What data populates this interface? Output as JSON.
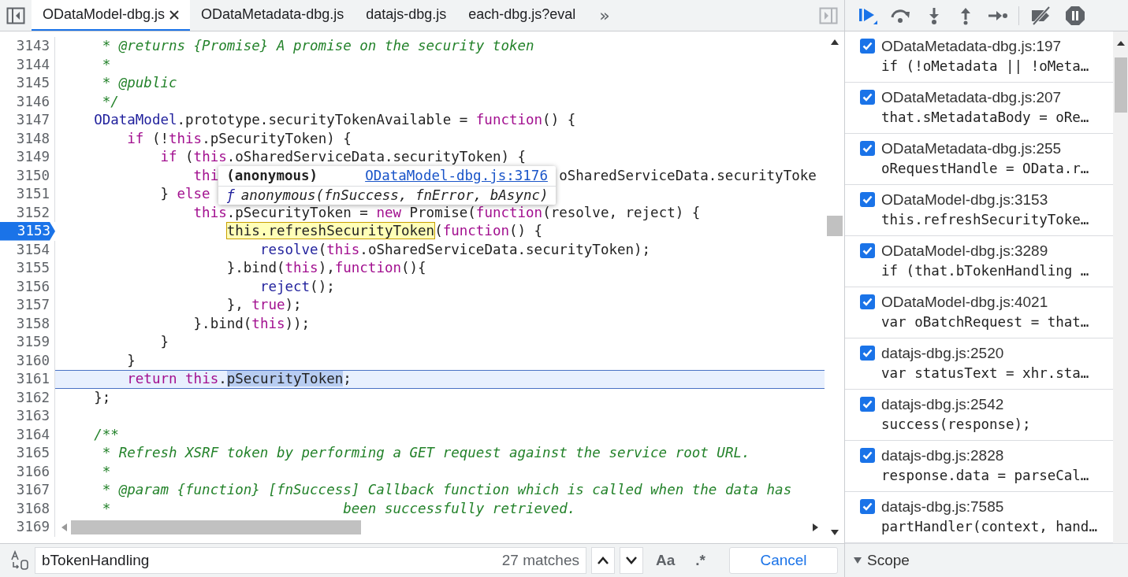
{
  "tabs": [
    {
      "label": "ODataModel-dbg.js",
      "selected": true
    },
    {
      "label": "ODataMetadata-dbg.js",
      "selected": false
    },
    {
      "label": "datajs-dbg.js",
      "selected": false
    },
    {
      "label": "each-dbg.js?eval",
      "selected": false
    }
  ],
  "more_tabs": "»",
  "code_lines": [
    {
      "number": "3143",
      "breakpoint": false,
      "highlighted": false,
      "tokens": [
        {
          "kind": "comment",
          "text": "     * @returns {Promise} A promise on the security token"
        }
      ]
    },
    {
      "number": "3144",
      "breakpoint": false,
      "highlighted": false,
      "tokens": [
        {
          "kind": "comment",
          "text": "     *"
        }
      ]
    },
    {
      "number": "3145",
      "breakpoint": false,
      "highlighted": false,
      "tokens": [
        {
          "kind": "comment",
          "text": "     * @public"
        }
      ]
    },
    {
      "number": "3146",
      "breakpoint": false,
      "highlighted": false,
      "tokens": [
        {
          "kind": "comment",
          "text": "     */"
        }
      ]
    },
    {
      "number": "3147",
      "breakpoint": false,
      "highlighted": false,
      "tokens": [
        {
          "kind": "name",
          "text": "    ODataModel"
        },
        {
          "kind": "plain",
          "text": ".prototype.securityTokenAvailable = "
        },
        {
          "kind": "keyword",
          "text": "function"
        },
        {
          "kind": "plain",
          "text": "() {"
        }
      ]
    },
    {
      "number": "3148",
      "breakpoint": false,
      "highlighted": false,
      "tokens": [
        {
          "kind": "keyword",
          "text": "        if"
        },
        {
          "kind": "plain",
          "text": " (!"
        },
        {
          "kind": "keyword",
          "text": "this"
        },
        {
          "kind": "plain",
          "text": ".pSecurityToken) {"
        }
      ]
    },
    {
      "number": "3149",
      "breakpoint": false,
      "highlighted": false,
      "tokens": [
        {
          "kind": "keyword",
          "text": "            if"
        },
        {
          "kind": "plain",
          "text": " ("
        },
        {
          "kind": "keyword",
          "text": "this"
        },
        {
          "kind": "plain",
          "text": ".oSharedServiceData.securityToken) {"
        }
      ]
    },
    {
      "number": "3150",
      "breakpoint": false,
      "highlighted": false,
      "tokens": [
        {
          "kind": "keyword",
          "text": "                thi"
        }
      ],
      "tail": [
        {
          "kind": "plain",
          "text": "oSharedServiceData.securityToke"
        }
      ]
    },
    {
      "number": "3151",
      "breakpoint": false,
      "highlighted": false,
      "tokens": [
        {
          "kind": "plain",
          "text": "            } "
        },
        {
          "kind": "keyword",
          "text": "else"
        }
      ]
    },
    {
      "number": "3152",
      "breakpoint": false,
      "highlighted": false,
      "tokens": [
        {
          "kind": "keyword",
          "text": "                this"
        },
        {
          "kind": "plain",
          "text": ".pSecurityToken = "
        },
        {
          "kind": "keyword",
          "text": "new"
        },
        {
          "kind": "plain",
          "text": " Promise("
        },
        {
          "kind": "keyword",
          "text": "function"
        },
        {
          "kind": "plain",
          "text": "(resolve, reject) {"
        }
      ]
    },
    {
      "number": "3153",
      "breakpoint": true,
      "highlighted": false,
      "tokens": [
        {
          "kind": "match",
          "text": "                    this.refreshSecurityToken"
        },
        {
          "kind": "plain",
          "text": "("
        },
        {
          "kind": "keyword",
          "text": "function"
        },
        {
          "kind": "plain",
          "text": "() {"
        }
      ]
    },
    {
      "number": "3154",
      "breakpoint": false,
      "highlighted": false,
      "tokens": [
        {
          "kind": "name",
          "text": "                        resolve"
        },
        {
          "kind": "plain",
          "text": "("
        },
        {
          "kind": "keyword",
          "text": "this"
        },
        {
          "kind": "plain",
          "text": ".oSharedServiceData.securityToken);"
        }
      ]
    },
    {
      "number": "3155",
      "breakpoint": false,
      "highlighted": false,
      "tokens": [
        {
          "kind": "plain",
          "text": "                    }.bind("
        },
        {
          "kind": "keyword",
          "text": "this"
        },
        {
          "kind": "plain",
          "text": "),"
        },
        {
          "kind": "keyword",
          "text": "function"
        },
        {
          "kind": "plain",
          "text": "(){"
        }
      ]
    },
    {
      "number": "3156",
      "breakpoint": false,
      "highlighted": false,
      "tokens": [
        {
          "kind": "name",
          "text": "                        reject"
        },
        {
          "kind": "plain",
          "text": "();"
        }
      ]
    },
    {
      "number": "3157",
      "breakpoint": false,
      "highlighted": false,
      "tokens": [
        {
          "kind": "plain",
          "text": "                    }, "
        },
        {
          "kind": "keyword",
          "text": "true"
        },
        {
          "kind": "plain",
          "text": ");"
        }
      ]
    },
    {
      "number": "3158",
      "breakpoint": false,
      "highlighted": false,
      "tokens": [
        {
          "kind": "plain",
          "text": "                }.bind("
        },
        {
          "kind": "keyword",
          "text": "this"
        },
        {
          "kind": "plain",
          "text": "));"
        }
      ]
    },
    {
      "number": "3159",
      "breakpoint": false,
      "highlighted": false,
      "tokens": [
        {
          "kind": "plain",
          "text": "            }"
        }
      ]
    },
    {
      "number": "3160",
      "breakpoint": false,
      "highlighted": false,
      "tokens": [
        {
          "kind": "plain",
          "text": "        }"
        }
      ]
    },
    {
      "number": "3161",
      "breakpoint": false,
      "highlighted": true,
      "tokens": [
        {
          "kind": "keyword",
          "text": "        return"
        },
        {
          "kind": "keyword",
          "text": " this"
        },
        {
          "kind": "plain",
          "text": "."
        },
        {
          "kind": "selection",
          "text": "pSecurityToken"
        },
        {
          "kind": "plain",
          "text": ";"
        }
      ]
    },
    {
      "number": "3162",
      "breakpoint": false,
      "highlighted": false,
      "tokens": [
        {
          "kind": "plain",
          "text": "    };"
        }
      ]
    },
    {
      "number": "3163",
      "breakpoint": false,
      "highlighted": false
    },
    {
      "number": "3164",
      "breakpoint": false,
      "highlighted": false,
      "tokens": [
        {
          "kind": "comment",
          "text": "    /**"
        }
      ]
    },
    {
      "number": "3165",
      "breakpoint": false,
      "highlighted": false,
      "tokens": [
        {
          "kind": "comment",
          "text": "     * Refresh XSRF token by performing a GET request against the service root URL."
        }
      ]
    },
    {
      "number": "3166",
      "breakpoint": false,
      "highlighted": false,
      "tokens": [
        {
          "kind": "comment",
          "text": "     *"
        }
      ]
    },
    {
      "number": "3167",
      "breakpoint": false,
      "highlighted": false,
      "tokens": [
        {
          "kind": "comment",
          "text": "     * @param {function} [fnSuccess] Callback function which is called when the data has"
        }
      ]
    },
    {
      "number": "3168",
      "breakpoint": false,
      "highlighted": false,
      "tokens": [
        {
          "kind": "comment",
          "text": "     *                            been successfully retrieved."
        }
      ]
    }
  ],
  "last_line_number": "3169",
  "tooltip": {
    "title": "(anonymous)",
    "link": "ODataModel-dbg.js:3176",
    "function_mark": "ƒ",
    "signature": "anonymous(fnSuccess, fnError, bAsync)"
  },
  "search": {
    "value": "bTokenHandling",
    "matches": "27 matches",
    "match_case": "Aa",
    "regex": ".*",
    "cancel": "Cancel"
  },
  "breakpoints": [
    {
      "location": "ODataMetadata-dbg.js:197",
      "code": "if (!oMetadata || !oMeta…",
      "checked": true
    },
    {
      "location": "ODataMetadata-dbg.js:207",
      "code": "that.sMetadataBody = oRe…",
      "checked": true
    },
    {
      "location": "ODataMetadata-dbg.js:255",
      "code": "oRequestHandle = OData.r…",
      "checked": true
    },
    {
      "location": "ODataModel-dbg.js:3153",
      "code": "this.refreshSecurityToke…",
      "checked": true
    },
    {
      "location": "ODataModel-dbg.js:3289",
      "code": "if (that.bTokenHandling …",
      "checked": true
    },
    {
      "location": "ODataModel-dbg.js:4021",
      "code": "var oBatchRequest = that…",
      "checked": true
    },
    {
      "location": "datajs-dbg.js:2520",
      "code": "var statusText = xhr.sta…",
      "checked": true
    },
    {
      "location": "datajs-dbg.js:2542",
      "code": "success(response);",
      "checked": true
    },
    {
      "location": "datajs-dbg.js:2828",
      "code": "response.data = parseCal…",
      "checked": true
    },
    {
      "location": "datajs-dbg.js:7585",
      "code": "partHandler(context, hand…",
      "checked": true
    }
  ],
  "scope": {
    "label": "Scope",
    "expanded": true
  }
}
